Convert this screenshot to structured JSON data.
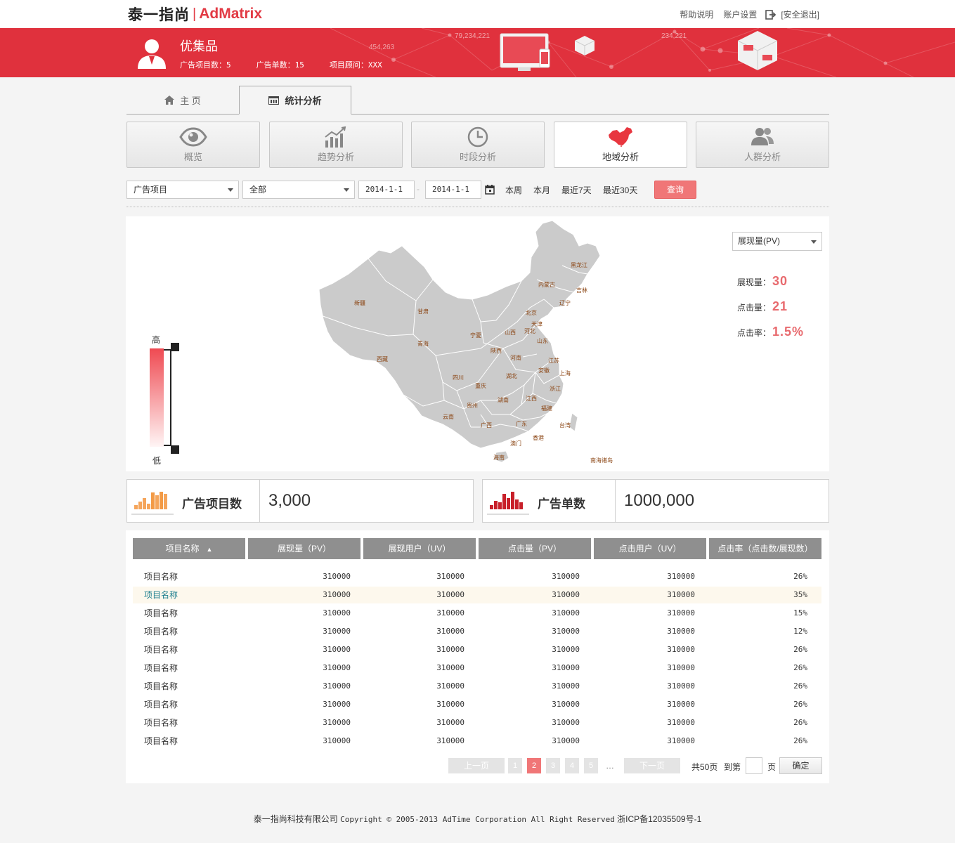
{
  "header": {
    "logo_cn": "泰一指尚",
    "logo_sep": "|",
    "logo_en": "AdMatrix",
    "links": {
      "help": "帮助说明",
      "account": "账户设置",
      "logout": "[安全退出]"
    }
  },
  "banner": {
    "company": "优集品",
    "stats": {
      "projects": "广告项目数：5",
      "orders": "广告单数：15",
      "advisor": "项目顾问：XXX"
    },
    "deco_numbers": [
      "79,234,221",
      "454,263",
      "234,221"
    ]
  },
  "tabs": [
    {
      "label": "主 页"
    },
    {
      "label": "统计分析"
    }
  ],
  "categories": [
    {
      "label": "概览",
      "icon": "eye-icon"
    },
    {
      "label": "趋势分析",
      "icon": "trend-chart-icon"
    },
    {
      "label": "时段分析",
      "icon": "clock-icon"
    },
    {
      "label": "地域分析",
      "icon": "china-map-icon"
    },
    {
      "label": "人群分析",
      "icon": "people-icon"
    }
  ],
  "filters": {
    "project_select": "广告项目",
    "scope_select": "全部",
    "date_from": "2014-1-1",
    "date_sep": "-",
    "date_to": "2014-1-1",
    "quick": {
      "week": "本周",
      "month": "本月",
      "last7": "最近7天",
      "last30": "最近30天"
    },
    "query": "查询"
  },
  "map": {
    "legend_high": "高",
    "legend_low": "低",
    "metric_select": "展现量(PV)",
    "metrics": [
      {
        "label": "展现量：",
        "value": "30"
      },
      {
        "label": "点击量：",
        "value": "21"
      },
      {
        "label": "点击率：",
        "value": "1.5%"
      }
    ],
    "provinces": [
      "黑龙江",
      "吉林",
      "辽宁",
      "内蒙古",
      "新疆",
      "甘肃",
      "宁夏",
      "青海",
      "西藏",
      "陕西",
      "山西",
      "北京",
      "天津",
      "河北",
      "山东",
      "河南",
      "江苏",
      "上海",
      "安徽",
      "湖北",
      "四川",
      "重庆",
      "浙江",
      "湖南",
      "江西",
      "贵州",
      "福建",
      "云南",
      "广西",
      "广东",
      "台湾",
      "香港",
      "澳门",
      "海南",
      "南海诸岛"
    ]
  },
  "summary": [
    {
      "label": "广告项目数",
      "value": "3,000",
      "icon": "orange-bars-icon"
    },
    {
      "label": "广告单数",
      "value": "1000,000",
      "icon": "red-bars-icon"
    }
  ],
  "table": {
    "headers": [
      "项目名称",
      "展现量（PV）",
      "展现用户（UV）",
      "点击量（PV）",
      "点击用户（UV）",
      "点击率（点击数/展现数）"
    ],
    "sort_icon": "sort-up-arrow-icon",
    "rows": [
      [
        "项目名称",
        "310000",
        "310000",
        "310000",
        "310000",
        "26%"
      ],
      [
        "项目名称",
        "310000",
        "310000",
        "310000",
        "310000",
        "35%"
      ],
      [
        "项目名称",
        "310000",
        "310000",
        "310000",
        "310000",
        "15%"
      ],
      [
        "项目名称",
        "310000",
        "310000",
        "310000",
        "310000",
        "12%"
      ],
      [
        "项目名称",
        "310000",
        "310000",
        "310000",
        "310000",
        "26%"
      ],
      [
        "项目名称",
        "310000",
        "310000",
        "310000",
        "310000",
        "26%"
      ],
      [
        "项目名称",
        "310000",
        "310000",
        "310000",
        "310000",
        "26%"
      ],
      [
        "项目名称",
        "310000",
        "310000",
        "310000",
        "310000",
        "26%"
      ],
      [
        "项目名称",
        "310000",
        "310000",
        "310000",
        "310000",
        "26%"
      ],
      [
        "项目名称",
        "310000",
        "310000",
        "310000",
        "310000",
        "26%"
      ]
    ]
  },
  "pager": {
    "prev": "上一页",
    "pages": [
      "1",
      "2",
      "3",
      "4",
      "5"
    ],
    "current": "2",
    "ellipsis": "…",
    "next": "下一页",
    "total": "共50页",
    "goto": "到第",
    "page_unit": "页",
    "confirm": "确定"
  },
  "footer": {
    "company": "泰一指尚科技有限公司",
    "copyright": "Copyright © 2005-2013 AdTime Corporation All Right Reserved",
    "icp": "浙ICP备12035509号-1"
  },
  "colors": {
    "brand_red": "#e0313d",
    "accent": "#f07677",
    "value_red": "#e86a6e",
    "map_gray": "#cccccc"
  }
}
